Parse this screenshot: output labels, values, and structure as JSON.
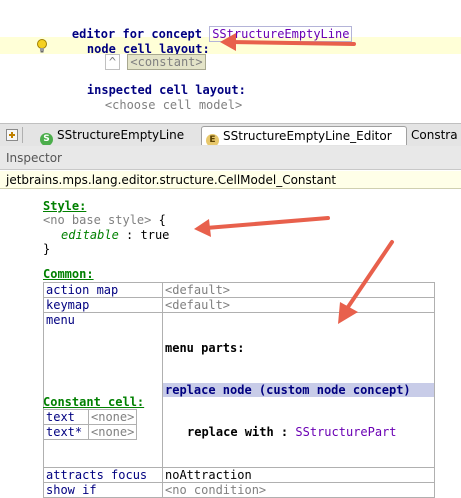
{
  "editor": {
    "line1_keyword": "editor for concept",
    "line1_concept": "SStructureEmptyLine",
    "line2_label": "node cell layout:",
    "line3_caret": "^",
    "line3_constant": "<constant>",
    "line4_label": "inspected cell layout:",
    "line5_placeholder": "<choose cell model>"
  },
  "tabs": [
    {
      "label": "SStructureEmptyLine",
      "icon": "S"
    },
    {
      "label": "SStructureEmptyLine_Editor",
      "icon": "E"
    },
    {
      "label": "Constra"
    }
  ],
  "inspector": {
    "title": "Inspector",
    "concept": "jetbrains.mps.lang.editor.structure.CellModel_Constant",
    "style_title": "Style:",
    "style_base": "<no base style>",
    "style_open": "{",
    "style_prop_name": "editable",
    "style_prop_sep": ":",
    "style_prop_value": "true",
    "style_close": "}",
    "common_title": "Common:",
    "common_rows": {
      "action_map_key": "action map",
      "action_map_val": "<default>",
      "keymap_key": "keymap",
      "keymap_val": "<default>",
      "menu_key": "menu",
      "menu_parts": "menu parts:",
      "replace_node": "replace node (custom node concept)",
      "replace_with_label": "replace with :",
      "replace_with_ref": "SStructurePart",
      "attracts_focus_key": "attracts focus",
      "attracts_focus_val": "noAttraction",
      "show_if_key": "show if",
      "show_if_val": "<no condition>"
    },
    "constant_title": "Constant cell:",
    "constant_rows": {
      "text_key": "text",
      "text_val": "<none>",
      "text_star_key": "text*",
      "text_star_val": "<none>"
    }
  },
  "colors": {
    "arrow": "#e8604c",
    "keyword": "#000080",
    "section": "#008000",
    "reference": "#6a00b4",
    "highlight": "#ffffd7"
  }
}
